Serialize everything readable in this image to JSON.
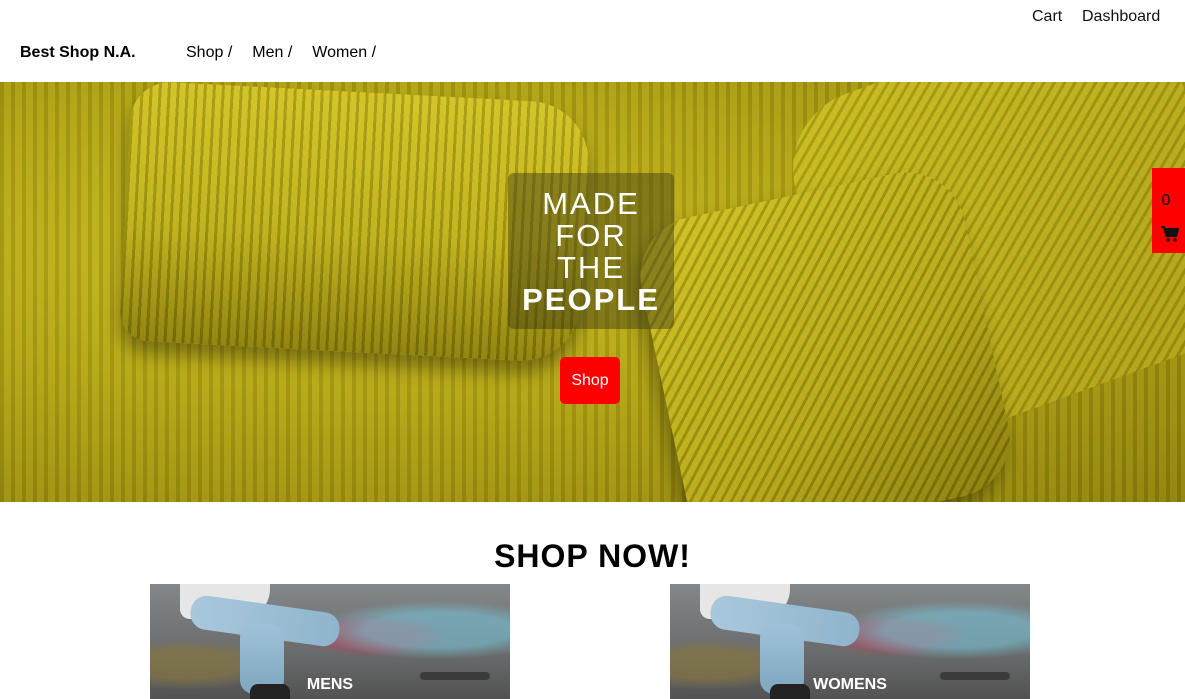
{
  "header": {
    "brand": "Best Shop N.A.",
    "nav": [
      {
        "label": "Shop /"
      },
      {
        "label": "Men /"
      },
      {
        "label": "Women /"
      }
    ],
    "utility_links": {
      "cart": "Cart",
      "dashboard": "Dashboard"
    }
  },
  "hero": {
    "lines": [
      "MADE",
      "FOR",
      "THE",
      "PEOPLE"
    ],
    "button_label": "Shop",
    "button_color": "#ff0000"
  },
  "cart_widget": {
    "count": "0",
    "icon": "shopping-cart-icon",
    "color": "#ff0000"
  },
  "section": {
    "title": "SHOP NOW!"
  },
  "categories": [
    {
      "label": "MENS"
    },
    {
      "label": "WOMENS"
    }
  ]
}
